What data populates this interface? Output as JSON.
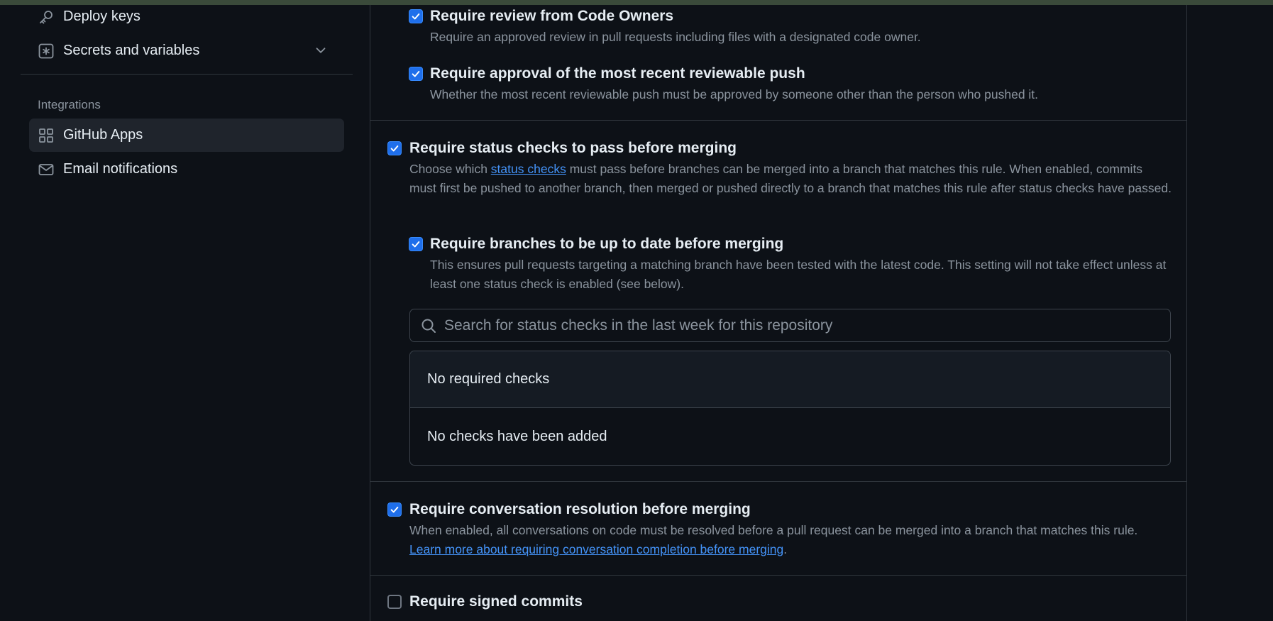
{
  "sidebar": {
    "items": [
      {
        "label": "Deploy keys",
        "icon": "key-icon"
      },
      {
        "label": "Secrets and variables",
        "icon": "asterisk-box-icon",
        "expandable": true
      }
    ],
    "integrations_heading": "Integrations",
    "integrations": [
      {
        "label": "GitHub Apps",
        "icon": "apps-grid-icon",
        "active": true
      },
      {
        "label": "Email notifications",
        "icon": "mail-icon"
      }
    ]
  },
  "rules": {
    "code_owners": {
      "title": "Require review from Code Owners",
      "desc": "Require an approved review in pull requests including files with a designated code owner.",
      "checked": true
    },
    "recent_push": {
      "title": "Require approval of the most recent reviewable push",
      "desc": "Whether the most recent reviewable push must be approved by someone other than the person who pushed it.",
      "checked": true
    },
    "status_checks": {
      "title": "Require status checks to pass before merging",
      "desc_before": "Choose which ",
      "desc_link": "status checks",
      "desc_after": " must pass before branches can be merged into a branch that matches this rule. When enabled, commits must first be pushed to another branch, then merged or pushed directly to a branch that matches this rule after status checks have passed.",
      "checked": true
    },
    "up_to_date": {
      "title": "Require branches to be up to date before merging",
      "desc": "This ensures pull requests targeting a matching branch have been tested with the latest code. This setting will not take effect unless at least one status check is enabled (see below).",
      "checked": true
    },
    "search": {
      "placeholder": "Search for status checks in the last week for this repository",
      "value": ""
    },
    "checks": {
      "header": "No required checks",
      "empty": "No checks have been added"
    },
    "conversation": {
      "title": "Require conversation resolution before merging",
      "desc": "When enabled, all conversations on code must be resolved before a pull request can be merged into a branch that matches this rule.",
      "link": "Learn more about requiring conversation completion before merging",
      "link_suffix": ".",
      "checked": true
    },
    "signed_commits": {
      "title": "Require signed commits",
      "checked": false
    }
  },
  "colors": {
    "background": "#0d1117",
    "accent": "#1f6feb",
    "link": "#4493f8",
    "muted_text": "#8b949e",
    "border": "#30363d"
  }
}
